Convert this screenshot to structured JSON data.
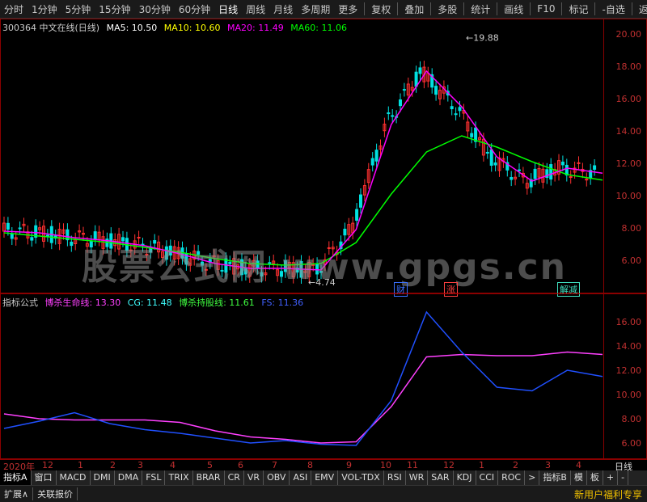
{
  "topbar": {
    "left": [
      "分时",
      "1分钟",
      "5分钟",
      "15分钟",
      "30分钟",
      "60分钟",
      "日线",
      "周线",
      "月线",
      "多周期",
      "更多"
    ],
    "active": "日线",
    "right": [
      "复权",
      "叠加",
      "多股",
      "统计",
      "画线",
      "F10",
      "标记",
      "-自选",
      "返回"
    ]
  },
  "main": {
    "stock": "300364 中文在线(日线)",
    "ma5": "MA5: 10.50",
    "ma10": "MA10: 10.60",
    "ma20": "MA20: 11.49",
    "ma60": "MA60: 11.06",
    "yticks": [
      "20.00",
      "18.00",
      "16.00",
      "14.00",
      "12.00",
      "10.00",
      "8.00",
      "6.00"
    ],
    "high_label": "19.88",
    "low_label": "4.74",
    "markers": [
      "财",
      "涨",
      "解减"
    ],
    "watermark": "股票公式网 www.gpgs.cn",
    "colors": {
      "ma5": "#ffffff",
      "ma10": "#ffff00",
      "ma20": "#ff00ff",
      "ma60": "#00ff00"
    }
  },
  "indicator": {
    "name": "指标公式",
    "l1": "博杀生命线: 13.30",
    "l2": "CG: 11.48",
    "l3": "博杀持股线: 11.61",
    "l4": "FS: 11.36",
    "yticks": [
      "16.00",
      "14.00",
      "12.00",
      "10.00",
      "8.00",
      "6.00"
    ]
  },
  "time_axis": [
    "2020年",
    "12",
    "1",
    "2",
    "3",
    "4",
    "5",
    "6",
    "7",
    "8",
    "9",
    "10",
    "11",
    "12",
    "1",
    "2",
    "3",
    "4"
  ],
  "tabs": [
    "指标A",
    "窗口",
    "MACD",
    "DMI",
    "DMA",
    "FSL",
    "TRIX",
    "BRAR",
    "CR",
    "VR",
    "OBV",
    "ASI",
    "EMV",
    "VOL-TDX",
    "RSI",
    "WR",
    "SAR",
    "KDJ",
    "CCI",
    "ROC",
    ">",
    "指标B",
    "模",
    "板"
  ],
  "bottom": {
    "b1": "扩展∧",
    "b2": "关联报价",
    "period": "日线",
    "plus": "+",
    "minus": "-",
    "right": "新用户福利专享"
  },
  "chart_data": {
    "type": "line",
    "title": "300364 中文在线(日线)",
    "price_range": [
      4.74,
      19.88
    ],
    "series": [
      {
        "name": "MA60",
        "values": [
          7.8,
          7.6,
          7.4,
          7.2,
          6.9,
          6.6,
          6.2,
          5.9,
          5.8,
          5.9,
          7.2,
          10.2,
          12.8,
          13.8,
          13.1,
          12.2,
          11.4,
          11.06
        ]
      },
      {
        "name": "MA20",
        "values": [
          7.9,
          7.8,
          7.5,
          7.3,
          7.0,
          6.5,
          5.9,
          5.6,
          5.6,
          5.5,
          8.0,
          14.5,
          17.8,
          15.6,
          12.5,
          11.0,
          11.8,
          11.49
        ]
      },
      {
        "name": "博杀生命线",
        "values": [
          8.4,
          8.0,
          7.9,
          7.9,
          7.9,
          7.7,
          7.0,
          6.5,
          6.3,
          6.0,
          6.1,
          9.0,
          13.1,
          13.3,
          13.2,
          13.2,
          13.5,
          13.3
        ]
      },
      {
        "name": "CG",
        "values": [
          7.2,
          7.8,
          8.5,
          7.6,
          7.1,
          6.8,
          6.4,
          6.0,
          6.2,
          5.9,
          5.8,
          9.5,
          16.8,
          13.5,
          10.6,
          10.3,
          12.0,
          11.48
        ]
      }
    ],
    "ind_range": [
      6.0,
      16.8
    ]
  }
}
